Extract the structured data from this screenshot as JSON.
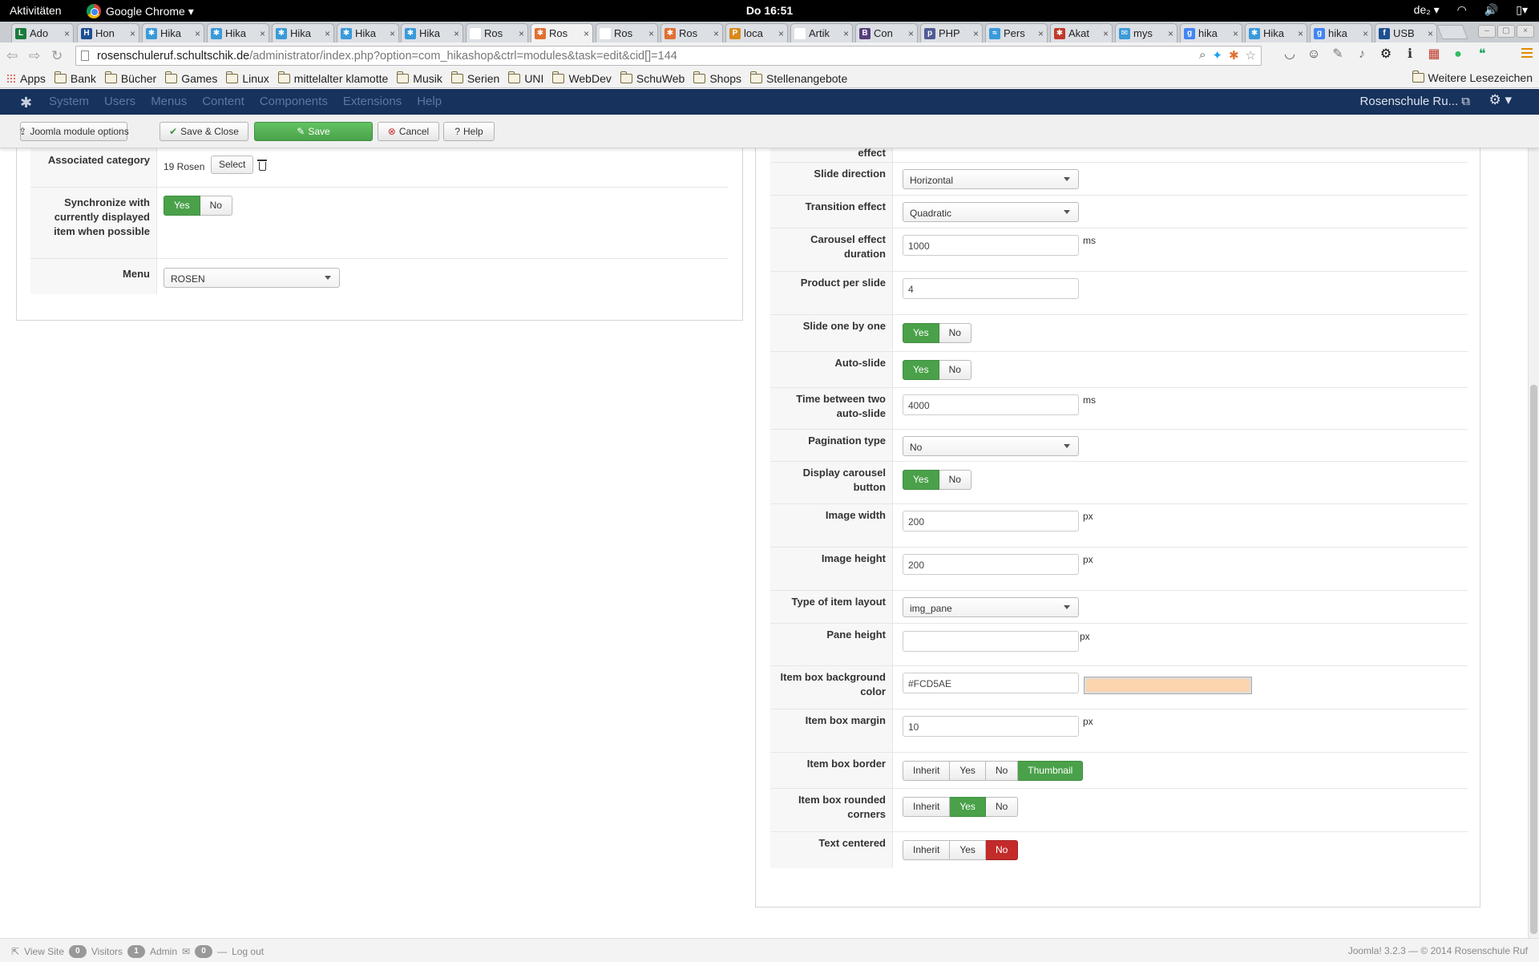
{
  "gnome": {
    "activities": "Aktivitäten",
    "app_menu": "Google Chrome ▾",
    "clock": "Do 16:51",
    "keyboard": "de₂ ▾"
  },
  "tabs": [
    {
      "label": "Ado",
      "color": "#1a7a3c",
      "letter": "L"
    },
    {
      "label": "Hon",
      "color": "#1d4f91",
      "letter": "H"
    },
    {
      "label": "Hika",
      "color": "#3a9ad9",
      "letter": "✱"
    },
    {
      "label": "Hika",
      "color": "#3a9ad9",
      "letter": "✱"
    },
    {
      "label": "Hika",
      "color": "#3a9ad9",
      "letter": "✱"
    },
    {
      "label": "Hika",
      "color": "#3a9ad9",
      "letter": "✱"
    },
    {
      "label": "Hika",
      "color": "#3a9ad9",
      "letter": "✱"
    },
    {
      "label": "Ros",
      "color": "#ffffff",
      "letter": ""
    },
    {
      "label": "Ros",
      "color": "#e07030",
      "letter": "✱",
      "active": true
    },
    {
      "label": "Ros",
      "color": "#ffffff",
      "letter": ""
    },
    {
      "label": "Ros",
      "color": "#e07030",
      "letter": "✱"
    },
    {
      "label": "loca",
      "color": "#d88a1b",
      "letter": "P"
    },
    {
      "label": "Artik",
      "color": "#ffffff",
      "letter": ""
    },
    {
      "label": "Con",
      "color": "#563d7c",
      "letter": "B"
    },
    {
      "label": "PHP",
      "color": "#4f5b93",
      "letter": "p"
    },
    {
      "label": "Pers",
      "color": "#3a9ad9",
      "letter": "≈"
    },
    {
      "label": "Akat",
      "color": "#c0392b",
      "letter": "✱"
    },
    {
      "label": "mys",
      "color": "#3a9ad9",
      "letter": "✉"
    },
    {
      "label": "hika",
      "color": "#4285f4",
      "letter": "g"
    },
    {
      "label": "Hika",
      "color": "#3a9ad9",
      "letter": "✱"
    },
    {
      "label": "hika",
      "color": "#4285f4",
      "letter": "g"
    },
    {
      "label": "USB",
      "color": "#1d4f91",
      "letter": "f"
    }
  ],
  "omnibox": {
    "domain": "rosenschuleruf.schultschik.de",
    "path": "/administrator/index.php?option=com_hikashop&ctrl=modules&task=edit&cid[]=144"
  },
  "bookmarks": {
    "apps": "Apps",
    "folders": [
      "Bank",
      "Bücher",
      "Games",
      "Linux",
      "mittelalter klamotte",
      "Musik",
      "Serien",
      "UNI",
      "WebDev",
      "SchuWeb",
      "Shops",
      "Stellenangebote"
    ],
    "more": "Weitere Lesezeichen"
  },
  "joomla_nav": {
    "menu": [
      "System",
      "Users",
      "Menus",
      "Content",
      "Components",
      "Extensions",
      "Help"
    ],
    "site_link": "Rosenschule Ru... ⧉",
    "gear": "⚙ ▾"
  },
  "joomla_toolbar": {
    "module_options": "Joomla module options",
    "save_close": "Save & Close",
    "save": "Save",
    "cancel": "Cancel",
    "help": "Help"
  },
  "left_panel": {
    "assoc_label": "Associated category",
    "assoc_value": "19 Rosen",
    "assoc_select": "Select",
    "sync_label": "Synchronize with currently displayed item when possible",
    "sync_yes": "Yes",
    "sync_no": "No",
    "menu_label": "Menu",
    "menu_value": "ROSEN"
  },
  "right_panel": {
    "effect_label": "effect",
    "slide_direction": {
      "label": "Slide direction",
      "value": "Horizontal"
    },
    "transition_effect": {
      "label": "Transition effect",
      "value": "Quadratic"
    },
    "carousel_duration": {
      "label": "Carousel effect duration",
      "value": "1000",
      "unit": "ms"
    },
    "product_per_slide": {
      "label": "Product per slide",
      "value": "4"
    },
    "slide_one_by_one": {
      "label": "Slide one by one",
      "yes": "Yes",
      "no": "No"
    },
    "auto_slide": {
      "label": "Auto-slide",
      "yes": "Yes",
      "no": "No"
    },
    "time_between": {
      "label": "Time between two auto-slide",
      "value": "4000",
      "unit": "ms"
    },
    "pagination_type": {
      "label": "Pagination type",
      "value": "No"
    },
    "display_carousel_button": {
      "label": "Display carousel button",
      "yes": "Yes",
      "no": "No"
    },
    "image_width": {
      "label": "Image width",
      "value": "200",
      "unit": "px"
    },
    "image_height": {
      "label": "Image height",
      "value": "200",
      "unit": "px"
    },
    "item_layout": {
      "label": "Type of item layout",
      "value": "img_pane"
    },
    "pane_height": {
      "label": "Pane height",
      "value": "",
      "unit": "px"
    },
    "item_bg_color": {
      "label": "Item box background color",
      "value": "#FCD5AE",
      "swatch": "#FCD5AE"
    },
    "item_margin": {
      "label": "Item box margin",
      "value": "10",
      "unit": "px"
    },
    "item_border": {
      "label": "Item box border",
      "options": [
        "Inherit",
        "Yes",
        "No",
        "Thumbnail"
      ]
    },
    "item_rounded": {
      "label": "Item box rounded corners",
      "options": [
        "Inherit",
        "Yes",
        "No"
      ]
    },
    "text_centered": {
      "label": "Text centered",
      "options": [
        "Inherit",
        "Yes",
        "No"
      ]
    }
  },
  "statusbar": {
    "view_site": "View Site",
    "visitors_count": "0",
    "visitors": "Visitors",
    "admin_count": "1",
    "admin": "Admin",
    "messages_count": "0",
    "logout": "Log out",
    "version": "Joomla! 3.2.3 — © 2014 Rosenschule Ruf"
  },
  "colors": {
    "joomla_nav": "#17325c",
    "green": "#4aa14a",
    "red": "#c32b2b"
  }
}
